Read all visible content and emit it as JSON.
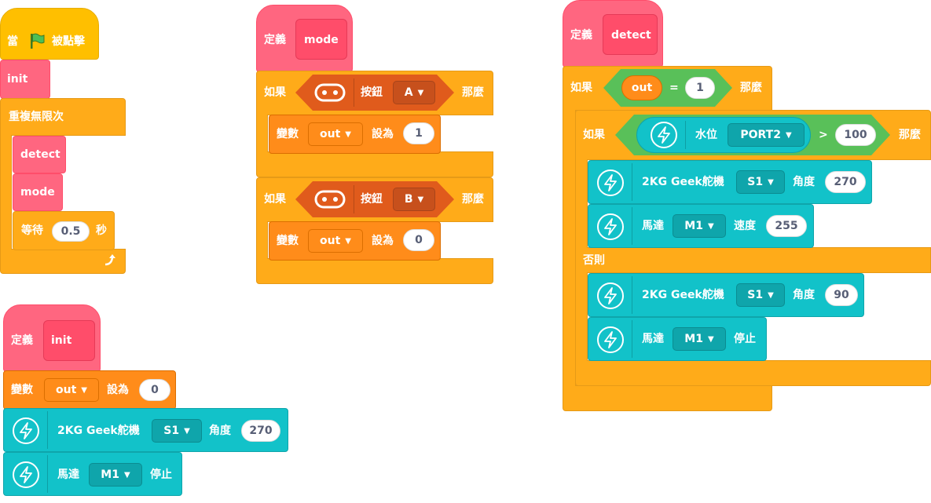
{
  "colors": {
    "events": "#ffbf00",
    "control": "#ffab19",
    "variables": "#ff8c1a",
    "myblocks": "#ff6680",
    "extension": "#12c2c9",
    "operators": "#59c059",
    "buttonReporter": "#e05b1c"
  },
  "script_main": {
    "when_flag": {
      "pre": "當",
      "post": "被點擊"
    },
    "call_init": "init",
    "forever": "重複無限次",
    "call_detect": "detect",
    "call_mode": "mode",
    "wait": {
      "pre": "等待",
      "value": "0.5",
      "post": "秒"
    }
  },
  "script_init": {
    "define": "定義",
    "name": "init",
    "setvar": {
      "label": "變數",
      "var": "out",
      "to": "設為",
      "value": "0"
    },
    "servo": {
      "label": "2KG Geek舵機",
      "port": "S1",
      "angle_label": "角度",
      "angle": "270"
    },
    "motor": {
      "label": "馬達",
      "port": "M1",
      "action": "停止"
    }
  },
  "script_mode": {
    "define": "定義",
    "name": "mode",
    "if1": {
      "if": "如果",
      "button_label": "按鈕",
      "button": "A",
      "then": "那麼",
      "setvar": {
        "label": "變數",
        "var": "out",
        "to": "設為",
        "value": "1"
      }
    },
    "if2": {
      "if": "如果",
      "button_label": "按鈕",
      "button": "B",
      "then": "那麼",
      "setvar": {
        "label": "變數",
        "var": "out",
        "to": "設為",
        "value": "0"
      }
    }
  },
  "script_detect": {
    "define": "定義",
    "name": "detect",
    "if_outer": {
      "if": "如果",
      "var": "out",
      "op": "=",
      "value": "1",
      "then": "那麼"
    },
    "if_inner": {
      "if": "如果",
      "sensor": "水位",
      "port": "PORT2",
      "op": ">",
      "value": "100",
      "then": "那麼"
    },
    "servo1": {
      "label": "2KG Geek舵機",
      "port": "S1",
      "angle_label": "角度",
      "angle": "270"
    },
    "motor1": {
      "label": "馬達",
      "port": "M1",
      "speed_label": "速度",
      "speed": "255"
    },
    "else": "否則",
    "servo2": {
      "label": "2KG Geek舵機",
      "port": "S1",
      "angle_label": "角度",
      "angle": "90"
    },
    "motor2": {
      "label": "馬達",
      "port": "M1",
      "action": "停止"
    }
  }
}
